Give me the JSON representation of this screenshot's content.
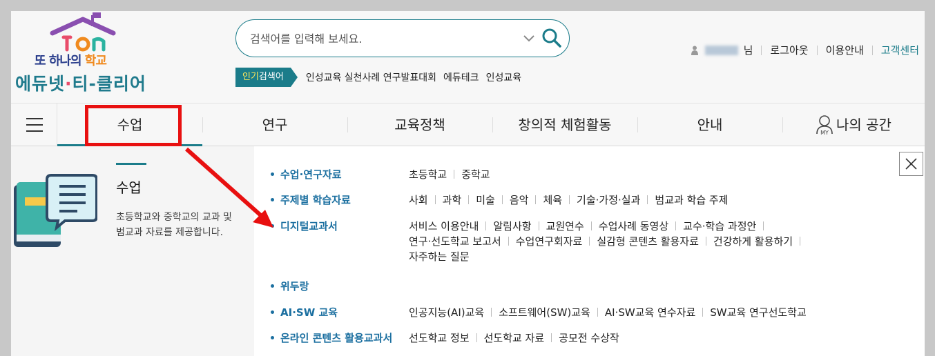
{
  "logo": {
    "line1_prefix": "또 하나의 ",
    "line1_highlight": "학교",
    "line2_a": "에듀넷",
    "line2_dot": "·",
    "line2_b": "티-클리어"
  },
  "search": {
    "placeholder": "검색어를 입력해 보세요."
  },
  "popular": {
    "tag_highlight": "인기",
    "tag_rest": "검색어",
    "keywords": [
      "인성교육 실천사례 연구발표대회",
      "에듀테크",
      "인성교육"
    ]
  },
  "util": {
    "suffix": "님",
    "logout": "로그아웃",
    "guide": "이용안내",
    "customer_center": "고객센터"
  },
  "gnb": {
    "items": [
      "수업",
      "연구",
      "교육정책",
      "창의적 체험활동",
      "안내"
    ],
    "my_space": "나의 공간"
  },
  "side": {
    "title": "수업",
    "description": "초등학교와 중학교의 교과 및 범교과 자료를 제공합니다."
  },
  "menu": [
    {
      "label": "수업·연구자료",
      "subs": [
        "초등학교",
        "중학교"
      ]
    },
    {
      "label": "주제별 학습자료",
      "subs": [
        "사회",
        "과학",
        "미술",
        "음악",
        "체육",
        "기술·가정·실과",
        "범교과 학습 주제"
      ]
    },
    {
      "label": "디지털교과서",
      "subs": [
        "서비스 이용안내",
        "알림사항",
        "교원연수",
        "수업사례 동영상",
        "교수·학습 과정안",
        "연구·선도학교 보고서",
        "수업연구회자료",
        "실감형 콘텐츠 활용자료",
        "건강하게 활용하기",
        "자주하는 질문"
      ]
    },
    {
      "label": "위두랑",
      "subs": []
    },
    {
      "label": "AI·SW 교육",
      "subs": [
        "인공지능(AI)교육",
        "소프트웨어(SW)교육",
        "AI·SW교육 연수자료",
        "SW교육 연구선도학교"
      ]
    },
    {
      "label": "온라인 콘텐츠 활용교과서",
      "subs": [
        "선도학교 정보",
        "선도학교 자료",
        "공모전 수상작"
      ]
    }
  ],
  "colors": {
    "accent": "#1b7c8a",
    "menu_link": "#1b6fa0",
    "highlight_box": "#e81010"
  }
}
